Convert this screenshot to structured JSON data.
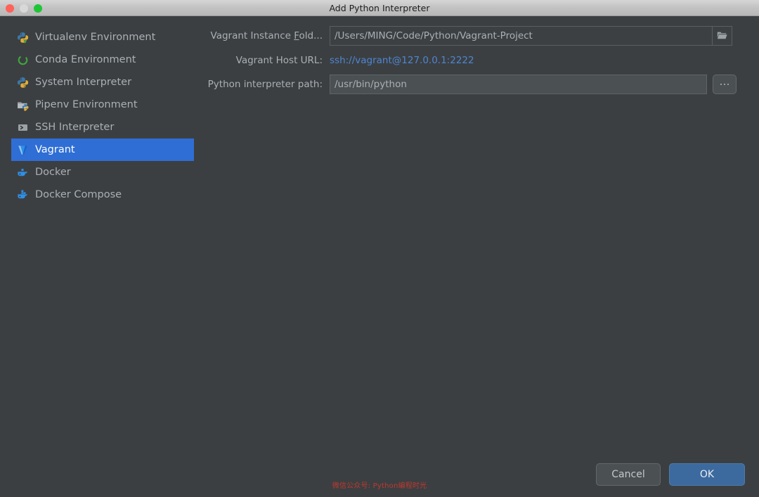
{
  "window": {
    "title": "Add Python Interpreter",
    "traffic_lights": [
      "close-button",
      "minimize-button",
      "maximize-button"
    ]
  },
  "sidebar": {
    "items": [
      {
        "label": "Virtualenv Environment",
        "icon": "python-virtualenv-icon",
        "selected": false
      },
      {
        "label": "Conda Environment",
        "icon": "conda-icon",
        "selected": false
      },
      {
        "label": "System Interpreter",
        "icon": "python-icon",
        "selected": false
      },
      {
        "label": "Pipenv Environment",
        "icon": "pipenv-folder-icon",
        "selected": false
      },
      {
        "label": "SSH Interpreter",
        "icon": "ssh-terminal-icon",
        "selected": false
      },
      {
        "label": "Vagrant",
        "icon": "vagrant-icon",
        "selected": true
      },
      {
        "label": "Docker",
        "icon": "docker-whale-icon",
        "selected": false
      },
      {
        "label": "Docker Compose",
        "icon": "docker-compose-icon",
        "selected": false
      }
    ]
  },
  "form": {
    "folder": {
      "label_prefix": "Vagrant Instance ",
      "label_mnemonic": "F",
      "label_suffix": "old...",
      "value": "/Users/MING/Code/Python/Vagrant-Project",
      "browse_icon": "folder-open-icon"
    },
    "host_url": {
      "label": "Vagrant Host URL:",
      "value": "ssh://vagrant@127.0.0.1:2222"
    },
    "interpreter_path": {
      "label": "Python interpreter path:",
      "value": "/usr/bin/python",
      "browse_label": "..."
    }
  },
  "buttons": {
    "cancel": "Cancel",
    "ok": "OK"
  },
  "watermark": {
    "text": "微信公众号: Python编程时光"
  },
  "colors": {
    "dialog_background": "#3c3f41",
    "selection_blue": "#2f6ed5",
    "link_blue": "#4d86d4",
    "ok_button_blue": "#3c6a9e",
    "label_text": "#a9b0b5",
    "watermark_red": "#c0382f"
  }
}
